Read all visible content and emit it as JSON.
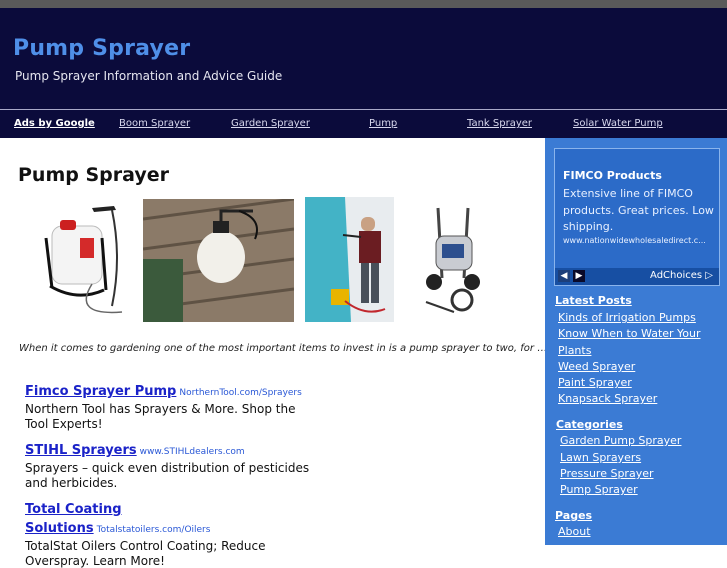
{
  "header": {
    "title": "Pump Sprayer",
    "tagline": "Pump Sprayer Information and Advice Guide"
  },
  "nav": {
    "ads_label": "Ads by Google",
    "links": [
      "Boom Sprayer",
      "Garden Sprayer",
      "Pump",
      "Tank Sprayer",
      "Solar Water Pump"
    ]
  },
  "main": {
    "title": "Pump Sprayer",
    "intro": "When it comes to gardening one of the most important items to invest in is a pump sprayer to two, for ….",
    "images": [
      "backpack-sprayer-image",
      "garden-sprayer-image",
      "painter-sprayer-image",
      "pressure-washer-image"
    ],
    "ads": [
      {
        "title": "Fimco Sprayer Pump",
        "url": "NorthernTool.com/Sprayers",
        "text": "Northern Tool has Sprayers & More. Shop the Tool Experts!"
      },
      {
        "title": "STIHL Sprayers",
        "url": "www.STIHLdealers.com",
        "text": "Sprayers – quick even distribution of pesticides and herbicides."
      },
      {
        "title": "Total Coating Solutions",
        "url": "Totalstatoilers.com/Oilers",
        "text": "TotalStat Oilers Control Coating; Reduce Overspray. Learn More!"
      }
    ]
  },
  "sidebar": {
    "ad": {
      "title": "FIMCO Products",
      "text": "Extensive line of FIMCO products. Great prices. Low shipping.",
      "url": "www.nationwidewholesaledirect.c...",
      "adchoices": "AdChoices ▷"
    },
    "latest_posts": {
      "heading": "Latest Posts",
      "items": [
        "Kinds of Irrigation Pumps",
        "Know When to Water Your",
        "Plants",
        "Weed Sprayer",
        "Paint Sprayer",
        "Knapsack Sprayer"
      ]
    },
    "categories": {
      "heading": "Categories",
      "items": [
        "Garden Pump Sprayer",
        "Lawn Sprayers",
        "Pressure Sprayer",
        "Pump Sprayer"
      ]
    },
    "pages": {
      "heading": "Pages",
      "items": [
        "About"
      ]
    }
  },
  "colors": {
    "header_bg": "#0b0b3b",
    "title_blue": "#4f8fe8",
    "sidebar_bg": "#3b7bd4",
    "ad_link": "#1a22c8"
  }
}
